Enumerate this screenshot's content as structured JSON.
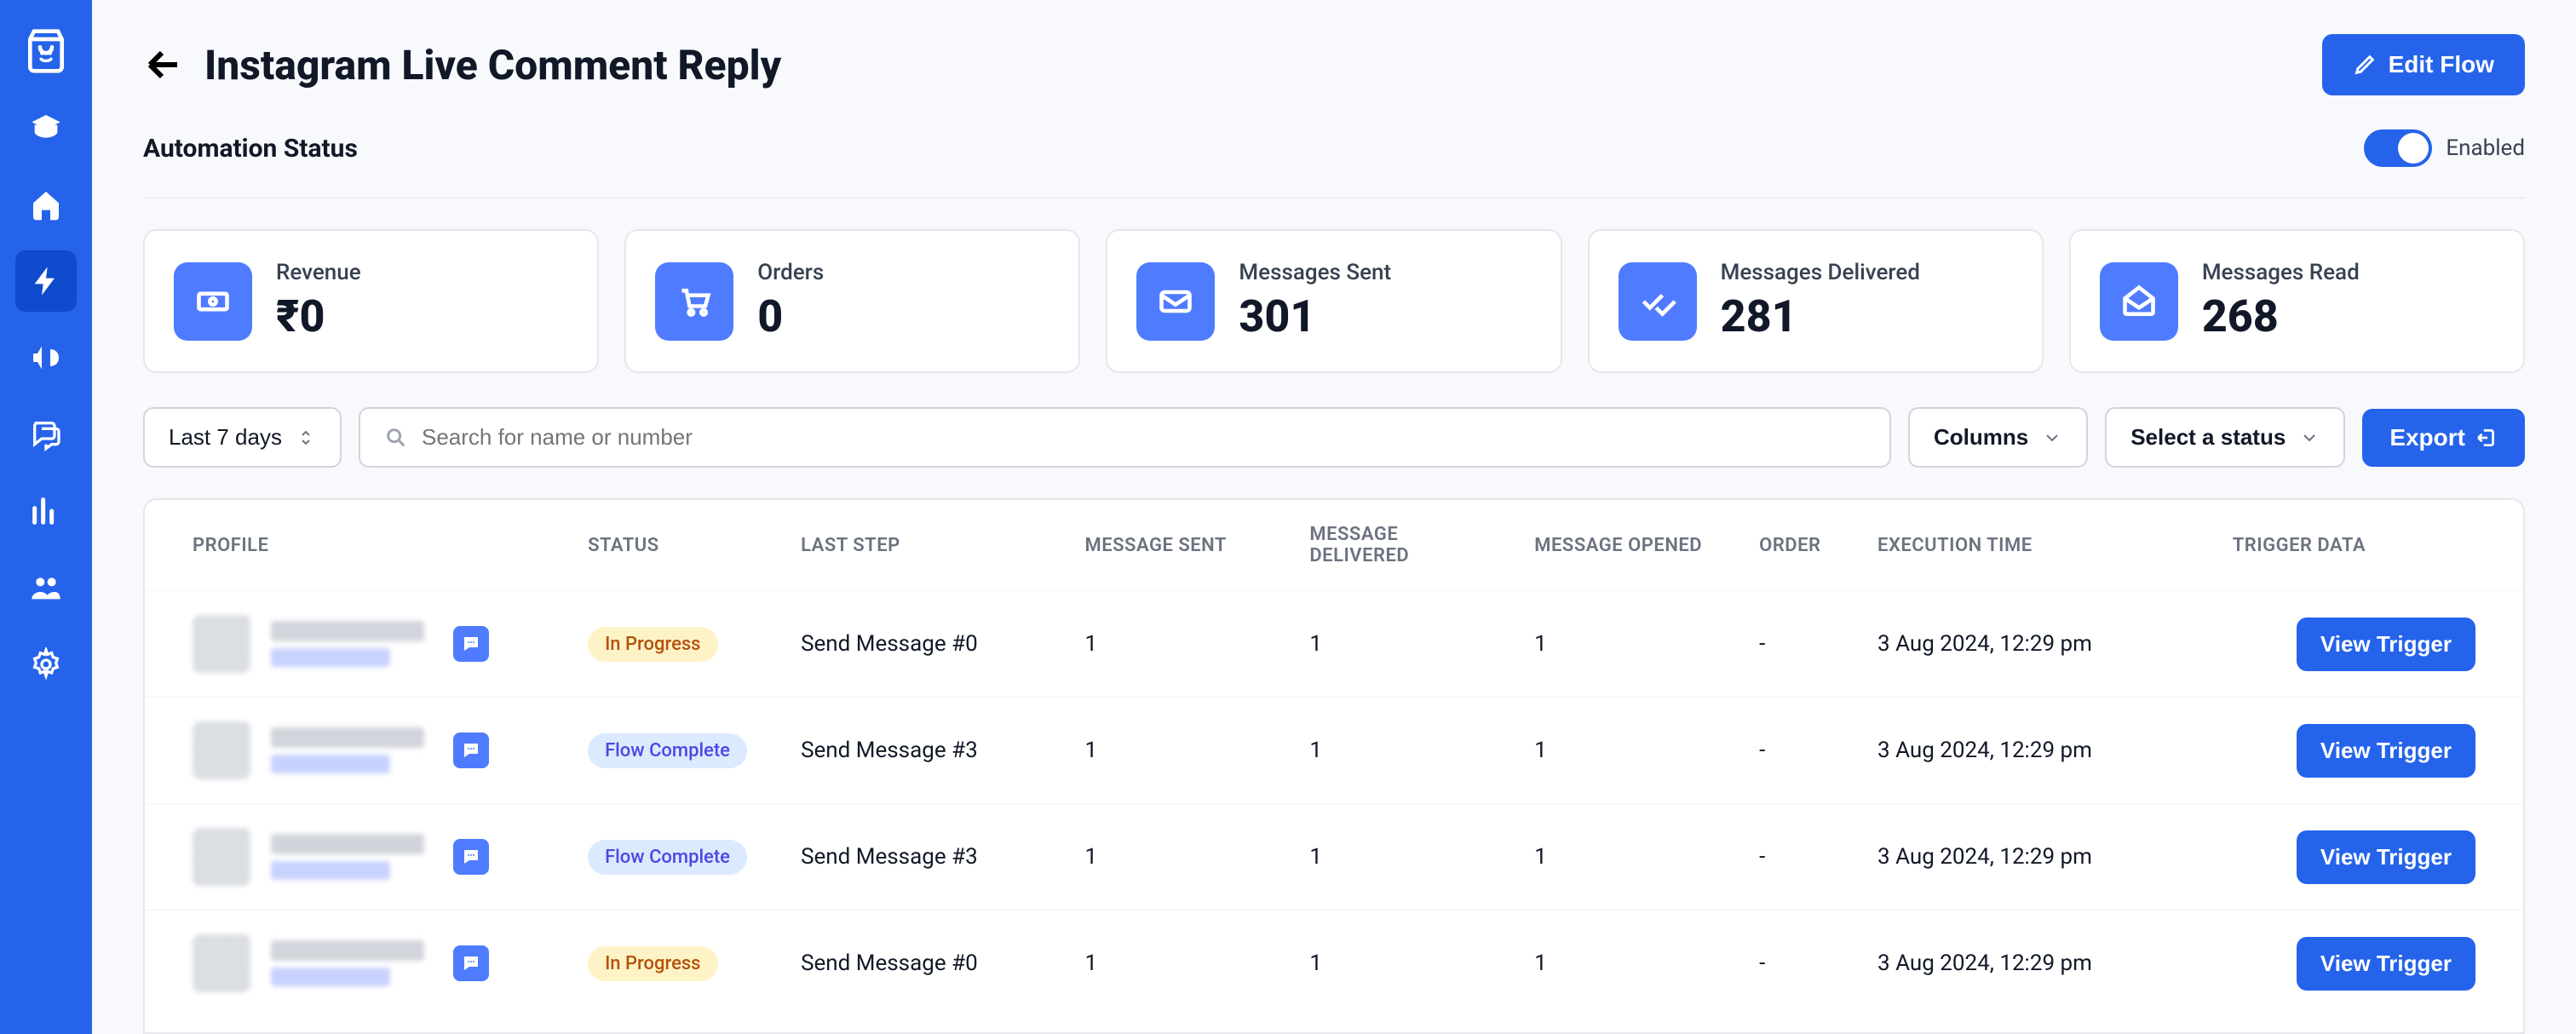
{
  "sidebar": {
    "logo": "shopping-bag",
    "items": [
      {
        "name": "education",
        "icon": "graduation-cap"
      },
      {
        "name": "home",
        "icon": "home"
      },
      {
        "name": "automation",
        "icon": "lightning",
        "active": true
      },
      {
        "name": "campaigns",
        "icon": "megaphone"
      },
      {
        "name": "conversations",
        "icon": "chat"
      },
      {
        "name": "analytics",
        "icon": "bar-chart"
      },
      {
        "name": "customers",
        "icon": "users"
      },
      {
        "name": "settings",
        "icon": "gear"
      }
    ]
  },
  "header": {
    "title": "Instagram Live Comment Reply",
    "edit_flow_label": "Edit Flow"
  },
  "automation_status": {
    "label": "Automation Status",
    "toggle_on": true,
    "toggle_label": "Enabled"
  },
  "stats": [
    {
      "icon": "money",
      "label": "Revenue",
      "value": "₹0"
    },
    {
      "icon": "cart",
      "label": "Orders",
      "value": "0"
    },
    {
      "icon": "envelope",
      "label": "Messages Sent",
      "value": "301"
    },
    {
      "icon": "double-check",
      "label": "Messages Delivered",
      "value": "281"
    },
    {
      "icon": "envelope-open",
      "label": "Messages Read",
      "value": "268"
    }
  ],
  "filters": {
    "date_range": "Last 7 days",
    "search_placeholder": "Search for name or number",
    "columns_label": "Columns",
    "status_label": "Select a status",
    "export_label": "Export"
  },
  "table": {
    "columns": [
      "PROFILE",
      "STATUS",
      "Last Step",
      "Message Sent",
      "Message Delivered",
      "Message Opened",
      "Order",
      "Execution Time",
      "Trigger Data"
    ],
    "rows": [
      {
        "status": "In Progress",
        "status_class": "in-progress",
        "last_step": "Send Message #0",
        "sent": "1",
        "delivered": "1",
        "opened": "1",
        "order": "-",
        "time": "3 Aug 2024, 12:29 pm",
        "trigger_label": "View Trigger"
      },
      {
        "status": "Flow Complete",
        "status_class": "flow-complete",
        "last_step": "Send Message #3",
        "sent": "1",
        "delivered": "1",
        "opened": "1",
        "order": "-",
        "time": "3 Aug 2024, 12:29 pm",
        "trigger_label": "View Trigger"
      },
      {
        "status": "Flow Complete",
        "status_class": "flow-complete",
        "last_step": "Send Message #3",
        "sent": "1",
        "delivered": "1",
        "opened": "1",
        "order": "-",
        "time": "3 Aug 2024, 12:29 pm",
        "trigger_label": "View Trigger"
      },
      {
        "status": "In Progress",
        "status_class": "in-progress",
        "last_step": "Send Message #0",
        "sent": "1",
        "delivered": "1",
        "opened": "1",
        "order": "-",
        "time": "3 Aug 2024, 12:29 pm",
        "trigger_label": "View Trigger"
      }
    ]
  }
}
